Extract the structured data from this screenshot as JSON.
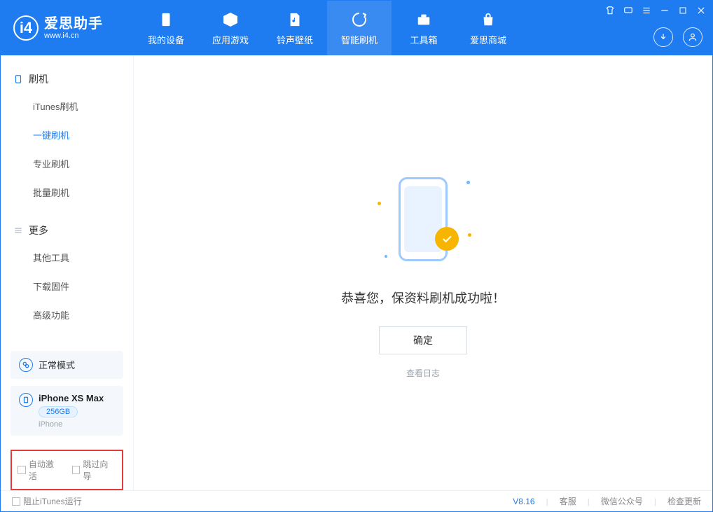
{
  "app": {
    "logo_title": "爱思助手",
    "logo_sub": "www.i4.cn",
    "logo_letter": "i4"
  },
  "tabs": {
    "my_device": "我的设备",
    "apps_games": "应用游戏",
    "ring_wall": "铃声壁纸",
    "smart_flash": "智能刷机",
    "toolbox": "工具箱",
    "store": "爱思商城"
  },
  "sidebar": {
    "section_flash": "刷机",
    "items_flash": {
      "itunes": "iTunes刷机",
      "oneclick": "一键刷机",
      "pro": "专业刷机",
      "batch": "批量刷机"
    },
    "section_more": "更多",
    "items_more": {
      "other_tools": "其他工具",
      "download_fw": "下载固件",
      "advanced": "高级功能"
    }
  },
  "device_status": {
    "normal_mode": "正常模式",
    "device_name": "iPhone XS Max",
    "capacity": "256GB",
    "device_type": "iPhone"
  },
  "options": {
    "auto_activate": "自动激活",
    "skip_guide": "跳过向导"
  },
  "main": {
    "success_text": "恭喜您，保资料刷机成功啦！",
    "ok_button": "确定",
    "view_log": "查看日志"
  },
  "statusbar": {
    "block_itunes": "阻止iTunes运行",
    "version": "V8.16",
    "support": "客服",
    "wechat": "微信公众号",
    "check_update": "检查更新"
  }
}
